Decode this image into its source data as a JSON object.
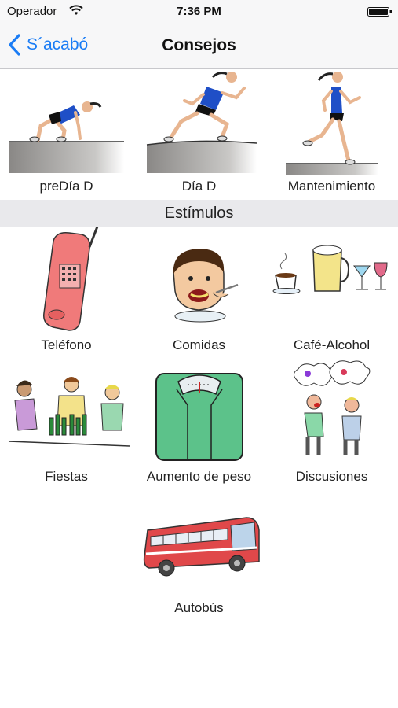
{
  "status_bar": {
    "carrier": "Operador",
    "time": "7:36 PM"
  },
  "nav": {
    "back_label": "S´acabó",
    "title": "Consejos"
  },
  "phases": [
    {
      "label": "preDía D",
      "icon": "runner-crouch-icon"
    },
    {
      "label": "Día D",
      "icon": "runner-start-icon"
    },
    {
      "label": "Mantenimiento",
      "icon": "runner-running-icon"
    }
  ],
  "section": {
    "title": "Estímulos"
  },
  "stimuli": [
    {
      "label": "Teléfono",
      "icon": "telephone-icon"
    },
    {
      "label": "Comidas",
      "icon": "eating-person-icon"
    },
    {
      "label": "Café-Alcohol",
      "icon": "coffee-drinks-icon"
    },
    {
      "label": "Fiestas",
      "icon": "party-people-icon"
    },
    {
      "label": "Aumento de peso",
      "icon": "scale-icon"
    },
    {
      "label": "Discusiones",
      "icon": "argument-icon"
    },
    {
      "label": "Autobús",
      "icon": "bus-icon"
    }
  ],
  "colors": {
    "accent": "#1a7cf5",
    "section_bg": "#e9e9ec",
    "bar_bg": "#f7f7f8"
  }
}
